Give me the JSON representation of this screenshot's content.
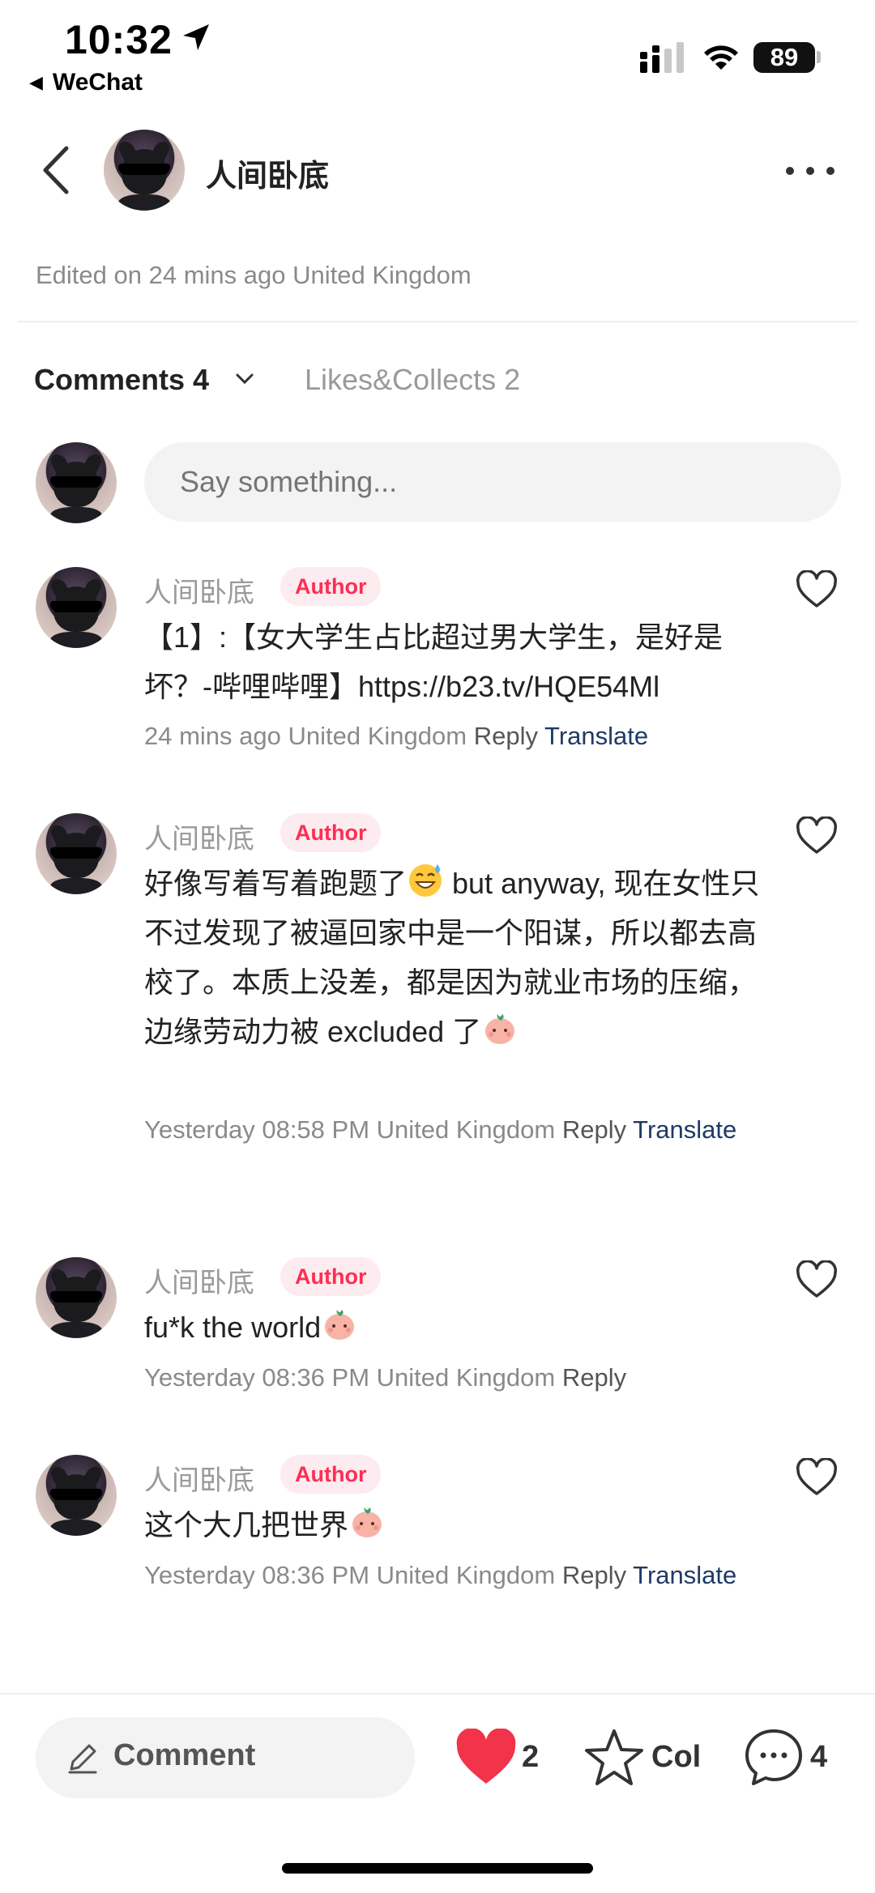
{
  "status_bar": {
    "time": "10:32",
    "back_app": "WeChat",
    "battery": "89"
  },
  "header": {
    "name": "人间卧底"
  },
  "post": {
    "edited": "Edited on 24 mins ago United Kingdom"
  },
  "tabs": {
    "comments": "Comments 4",
    "likes_collects": "Likes&Collects 2"
  },
  "input": {
    "placeholder": "Say something..."
  },
  "comments": [
    {
      "name": "人间卧底",
      "badge": "Author",
      "text": "【1】:【女大学生占比超过男大学生，是好是坏？-哔哩哔哩】https://b23.tv/HQE54Ml",
      "meta": "24 mins ago United Kingdom",
      "reply": "Reply",
      "translate": "Translate"
    },
    {
      "name": "人间卧底",
      "badge": "Author",
      "text_before_emoji": "好像写着写着跑题了",
      "text_after_emoji": " but anyway, 现在女性只不过发现了被逼回家中是一个阳谋，所以都去高校了。本质上没差，都是因为就业市场的压缩，边缘劳动力被 excluded 了",
      "meta": "Yesterday 08:58 PM United Kingdom",
      "reply": "Reply",
      "translate": "Translate"
    },
    {
      "name": "人间卧底",
      "badge": "Author",
      "text": "fu*k the world",
      "meta": "Yesterday 08:36 PM United Kingdom",
      "reply": "Reply"
    },
    {
      "name": "人间卧底",
      "badge": "Author",
      "text": "这个大几把世界",
      "meta": "Yesterday 08:36 PM United Kingdom",
      "reply": "Reply",
      "translate": "Translate"
    }
  ],
  "bottom_bar": {
    "comment_label": "Comment",
    "like_count": "2",
    "collect_label": "Col",
    "comment_count": "4"
  },
  "colors": {
    "author_badge_text": "#ff2d55",
    "author_badge_bg": "#fdecef",
    "translate_link": "#1f3a66",
    "like_heart": "#f2334a"
  },
  "icons": {
    "location": "location-arrow-icon",
    "back": "chevron-left-icon",
    "more": "more-dots-icon",
    "heart": "heart-outline-icon",
    "like": "heart-filled-icon",
    "collect": "star-outline-icon",
    "chat": "chat-bubble-icon",
    "pen": "pen-icon",
    "sweat_emoji": "grinning-sweat-emoji",
    "peach_emoji": "peach-face-emoji"
  }
}
